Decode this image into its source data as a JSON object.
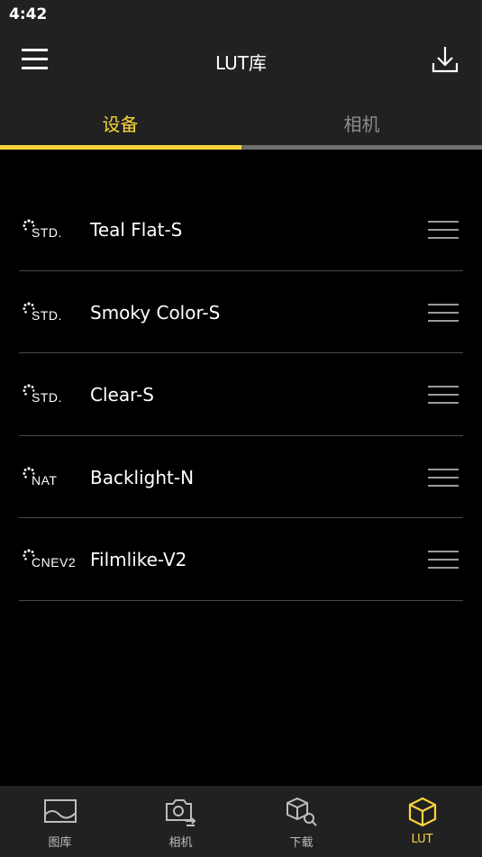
{
  "status_bar": {
    "time": "4:42"
  },
  "header": {
    "title": "LUT库"
  },
  "tabs": [
    {
      "label": "设备",
      "active": true
    },
    {
      "label": "相机",
      "active": false
    }
  ],
  "luts": [
    {
      "badge": "STD.",
      "name": "Teal Flat-S"
    },
    {
      "badge": "STD.",
      "name": "Smoky Color-S"
    },
    {
      "badge": "STD.",
      "name": "Clear-S"
    },
    {
      "badge": "NAT",
      "name": "Backlight-N"
    },
    {
      "badge": "CNEV2",
      "name": "Filmlike-V2"
    }
  ],
  "bottom_nav": [
    {
      "label": "图库",
      "icon": "gallery-icon",
      "active": false
    },
    {
      "label": "相机",
      "icon": "camera-switch-icon",
      "active": false
    },
    {
      "label": "下载",
      "icon": "cube-search-icon",
      "active": false
    },
    {
      "label": "LUT",
      "icon": "lut-cube-icon",
      "active": true
    }
  ],
  "colors": {
    "accent": "#f8d43a",
    "header_bg": "#212121",
    "background": "#000000",
    "divider": "#4a4a4a"
  }
}
